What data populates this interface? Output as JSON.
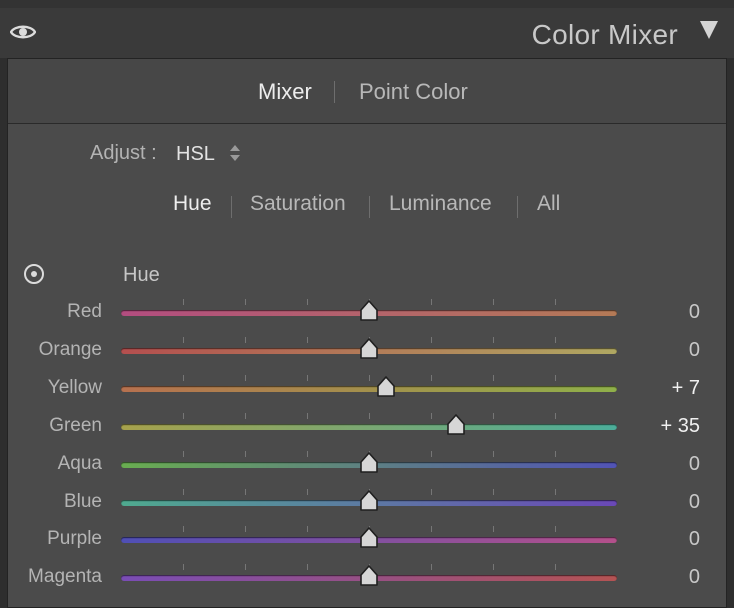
{
  "header": {
    "title": "Color Mixer",
    "eye_icon": "eye-icon",
    "collapse_icon": "triangle-down-icon"
  },
  "modes": {
    "mixer": "Mixer",
    "point_color": "Point Color",
    "active": "Mixer"
  },
  "adjust": {
    "label": "Adjust :",
    "value": "HSL"
  },
  "subtabs": {
    "hue": "Hue",
    "saturation": "Saturation",
    "luminance": "Luminance",
    "all": "All",
    "active": "Hue"
  },
  "section": {
    "title": "Hue",
    "target_icon": "target-adjust-icon"
  },
  "sliders": [
    {
      "label": "Red",
      "value": "0",
      "level": 0,
      "gradient": [
        "#b34d80",
        "#b47a56"
      ]
    },
    {
      "label": "Orange",
      "value": "0",
      "level": 0,
      "gradient": [
        "#b44f4f",
        "#b0a862"
      ]
    },
    {
      "label": "Yellow",
      "value": "+ 7",
      "level": 7,
      "gradient": [
        "#b7714f",
        "#8fb04a"
      ]
    },
    {
      "label": "Green",
      "value": "+ 35",
      "level": 35,
      "gradient": [
        "#a7a24c",
        "#4cae9a"
      ]
    },
    {
      "label": "Aqua",
      "value": "0",
      "level": 0,
      "gradient": [
        "#69ad50",
        "#5153b6"
      ]
    },
    {
      "label": "Blue",
      "value": "0",
      "level": 0,
      "gradient": [
        "#4faa8f",
        "#6a48b7"
      ]
    },
    {
      "label": "Purple",
      "value": "0",
      "level": 0,
      "gradient": [
        "#4f4fb5",
        "#b4508b"
      ]
    },
    {
      "label": "Magenta",
      "value": "0",
      "level": 0,
      "gradient": [
        "#7a4db5",
        "#b45353"
      ]
    }
  ],
  "slider_range": [
    -100,
    100
  ]
}
